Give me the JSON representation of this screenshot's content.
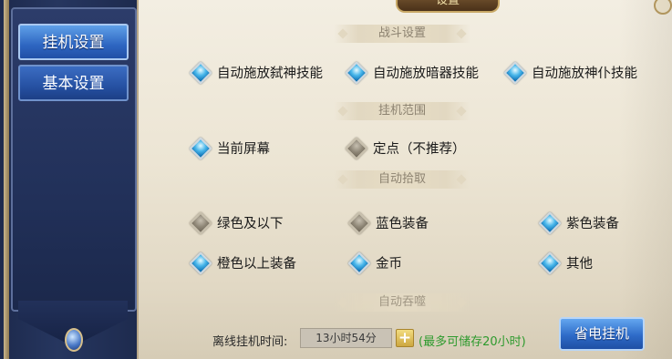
{
  "window": {
    "title": "设置"
  },
  "sidebar": {
    "items": [
      {
        "label": "挂机设置",
        "active": true
      },
      {
        "label": "基本设置",
        "active": false
      }
    ]
  },
  "sections": {
    "combat": {
      "header": "战斗设置",
      "options": [
        {
          "label": "自动施放弑神技能",
          "checked": true
        },
        {
          "label": "自动施放暗器技能",
          "checked": true
        },
        {
          "label": "自动施放神仆技能",
          "checked": true
        }
      ]
    },
    "range": {
      "header": "挂机范围",
      "options": [
        {
          "label": "当前屏幕",
          "checked": true
        },
        {
          "label": "定点（不推荐）",
          "checked": false
        }
      ]
    },
    "pickup": {
      "header": "自动拾取",
      "options": [
        {
          "label": "绿色及以下",
          "checked": false
        },
        {
          "label": "蓝色装备",
          "checked": false
        },
        {
          "label": "紫色装备",
          "checked": true
        },
        {
          "label": "橙色以上装备",
          "checked": true
        },
        {
          "label": "金币",
          "checked": true
        },
        {
          "label": "其他",
          "checked": true
        }
      ]
    },
    "devour": {
      "header": "自动吞噬"
    }
  },
  "footer": {
    "offline_label": "离线挂机时间:",
    "offline_time": "13小时54分",
    "plus_label": "+",
    "note": "(最多可储存20小时)",
    "power_button": "省电挂机"
  },
  "colors": {
    "checked_gem": "#48b6ea",
    "unchecked_gem": "#8e8676",
    "note_green": "#2d9a2d",
    "nav_blue": "#2e66c1"
  },
  "icons": {
    "checked": "diamond-gem-blue",
    "unchecked": "diamond-gem-gray"
  }
}
